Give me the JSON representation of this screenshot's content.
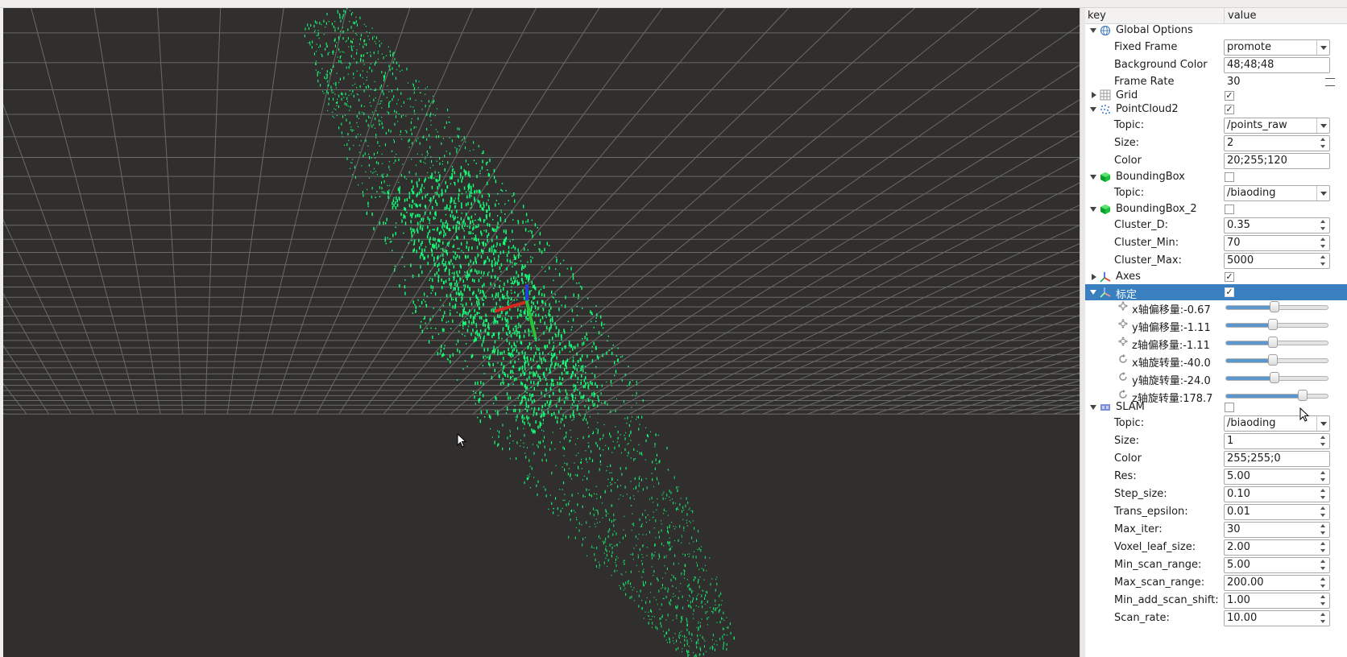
{
  "panel": {
    "header": {
      "key": "key",
      "value": "value"
    },
    "global_options": {
      "label": "Global Options",
      "fixed_frame_label": "Fixed Frame",
      "fixed_frame_value": "promote",
      "background_color_label": "Background Color",
      "background_color_value": "48;48;48",
      "frame_rate_label": "Frame Rate",
      "frame_rate_value": "30"
    },
    "grid": {
      "label": "Grid",
      "checked": "✓"
    },
    "pointcloud2": {
      "label": "PointCloud2",
      "checked": "✓",
      "topic_label": "Topic:",
      "topic_value": "/points_raw",
      "size_label": "Size:",
      "size_value": "2",
      "color_label": "Color",
      "color_value": "20;255;120"
    },
    "boundingbox": {
      "label": "BoundingBox",
      "topic_label": "Topic:",
      "topic_value": "/biaoding"
    },
    "boundingbox_2": {
      "label": "BoundingBox_2",
      "cluster_d_label": "Cluster_D:",
      "cluster_d_value": "0.35",
      "cluster_min_label": "Cluster_Min:",
      "cluster_min_value": "70",
      "cluster_max_label": "Cluster_Max:",
      "cluster_max_value": "5000"
    },
    "axes": {
      "label": "Axes",
      "checked": "✓"
    },
    "biaoding": {
      "label": "标定",
      "checked": "✓",
      "sliders": [
        {
          "label": "x轴偏移量:-0.67",
          "level": 0.47
        },
        {
          "label": "y轴偏移量:-1.11",
          "level": 0.45
        },
        {
          "label": "z轴偏移量:-1.11",
          "level": 0.45
        },
        {
          "label": "x轴旋转量:-40.0",
          "level": 0.45
        },
        {
          "label": "y轴旋转量:-24.0",
          "level": 0.47
        },
        {
          "label": "z轴旋转量:178.7",
          "level": 0.74
        }
      ]
    },
    "slam": {
      "label": "SLAM",
      "topic_label": "Topic:",
      "topic_value": "/biaoding",
      "size_label": "Size:",
      "size_value": "1",
      "color_label": "Color",
      "color_value": "255;255;0",
      "res_label": "Res:",
      "res_value": "5.00",
      "step_size_label": "Step_size:",
      "step_size_value": "0.10",
      "trans_epsilon_label": "Trans_epsilon:",
      "trans_epsilon_value": "0.01",
      "max_iter_label": "Max_iter:",
      "max_iter_value": "30",
      "voxel_leaf_size_label": "Voxel_leaf_size:",
      "voxel_leaf_size_value": "2.00",
      "min_scan_range_label": "Min_scan_range:",
      "min_scan_range_value": "5.00",
      "max_scan_range_label": "Max_scan_range:",
      "max_scan_range_value": "200.00",
      "min_add_scan_shift_label": "Min_add_scan_shift:",
      "min_add_scan_shift_value": "1.00",
      "scan_rate_label": "Scan_rate:",
      "scan_rate_value": "10.00"
    }
  },
  "colors": {
    "viewport_bg": "#302f2d",
    "grid_line": "#6a6a68",
    "point_cloud": "#14ff78",
    "selection": "#3a80c0"
  },
  "icons": [
    "globe-icon",
    "grid-icon",
    "pointcloud-icon",
    "cube-icon",
    "axes-icon",
    "move-icon",
    "rotate-icon",
    "slam-icon"
  ]
}
